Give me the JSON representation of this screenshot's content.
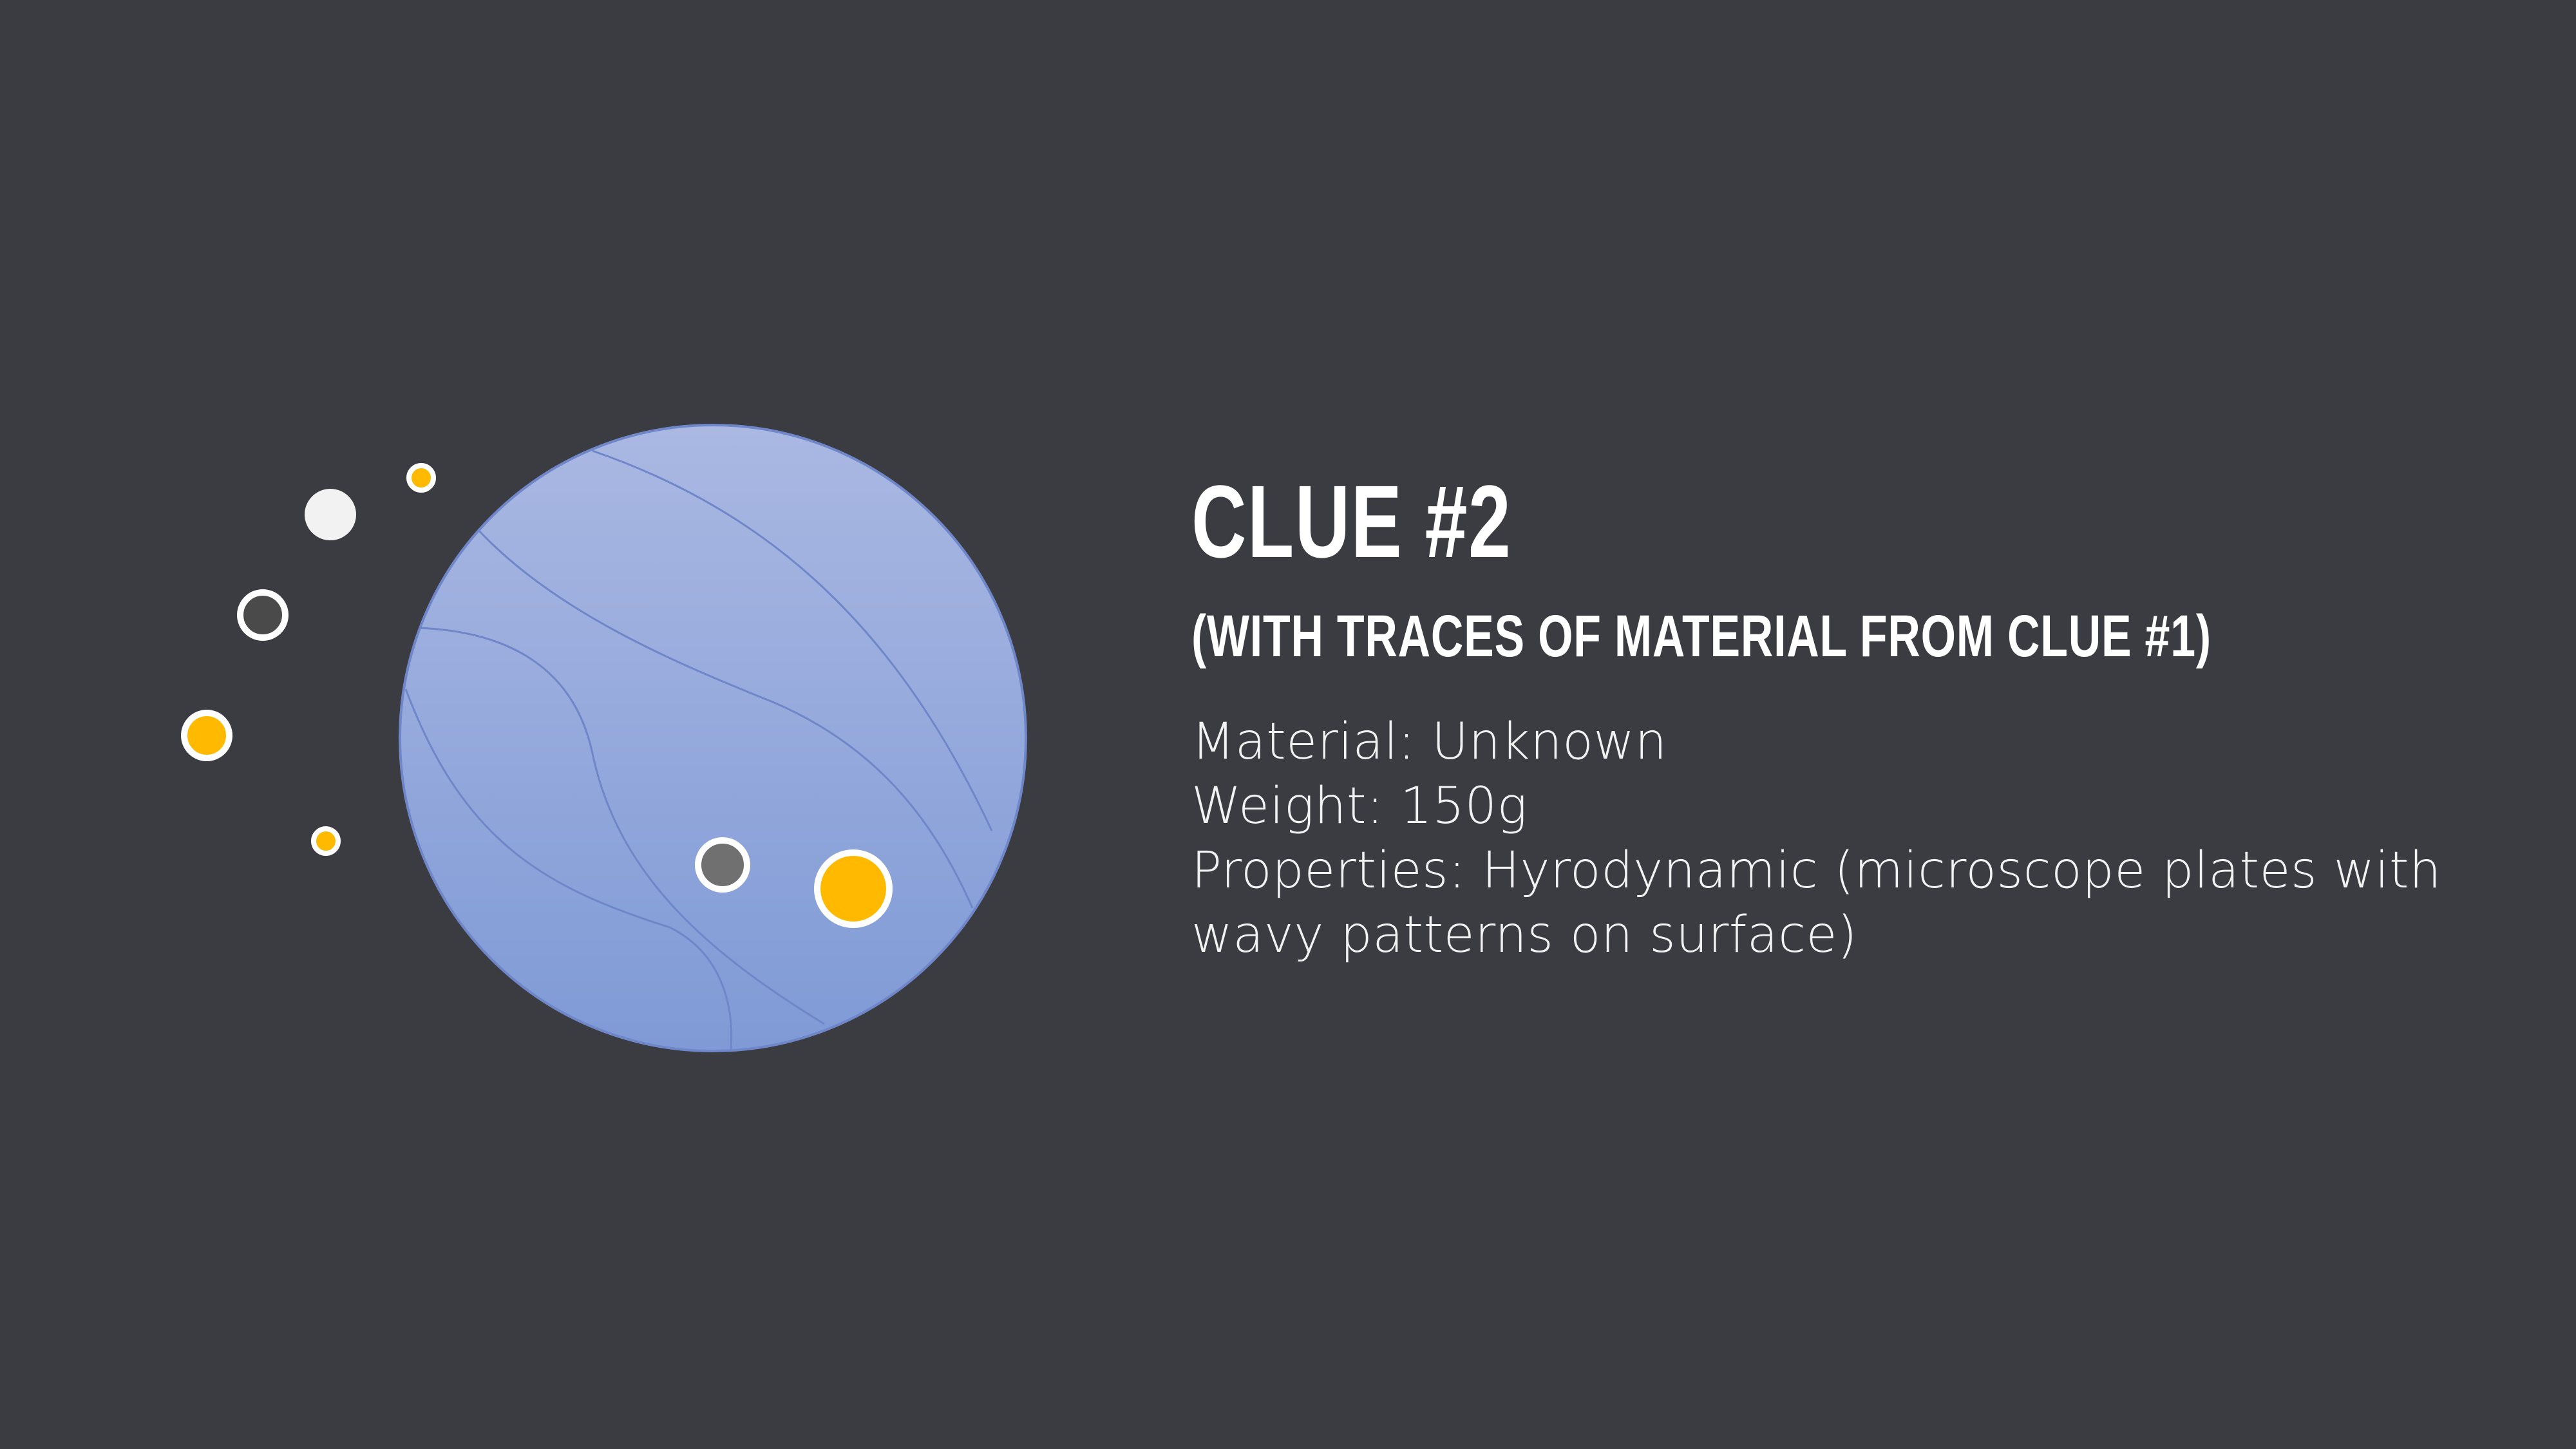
{
  "slide": {
    "title": "Clue #2",
    "subtitle": "(with traces of material from Clue #1)",
    "details": {
      "material": "Material: Unknown",
      "weight": "Weight: 150g",
      "properties": "Properties: Hyrodynamic (microscope plates with wavy patterns on surface)"
    }
  },
  "colors": {
    "background": "#3b3c42",
    "planet_top": "#aab8e2",
    "planet_bottom": "#7f9ad6",
    "orbit_line": "#6f86c9",
    "accent_yellow": "#ffba00",
    "dot_white": "#f2f2f2",
    "dot_dark": "#4a4a4a",
    "dot_gray": "#707070"
  },
  "icons": [
    "planet-illustration",
    "white-dot-icon",
    "yellow-small-dot-icon",
    "dark-ring-dot-icon",
    "yellow-ring-dot-icon",
    "yellow-tiny-dot-icon",
    "gray-ring-dot-icon",
    "yellow-large-dot-icon"
  ]
}
